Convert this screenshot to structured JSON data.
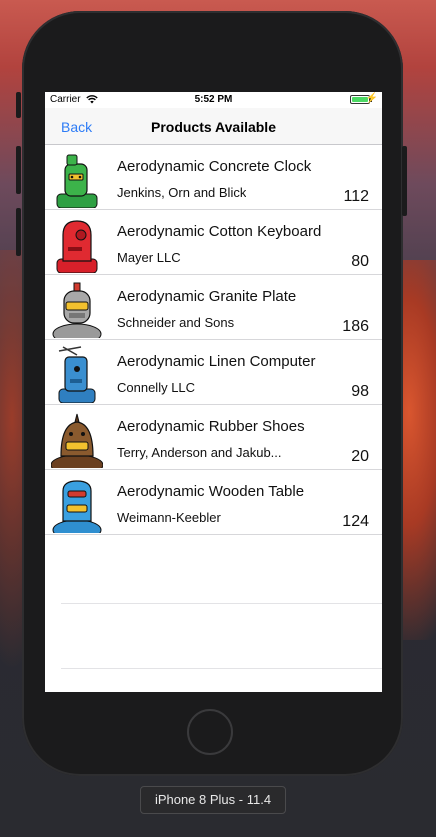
{
  "status_bar": {
    "carrier": "Carrier",
    "time": "5:52 PM",
    "battery_level": 1.0
  },
  "nav": {
    "back_label": "Back",
    "title": "Products Available"
  },
  "products": [
    {
      "name": "Aerodynamic Concrete Clock",
      "maker": "Jenkins, Orn and Blick",
      "quantity": "112",
      "avatar_color": "#2ea043"
    },
    {
      "name": "Aerodynamic Cotton Keyboard",
      "maker": "Mayer LLC",
      "quantity": "80",
      "avatar_color": "#d8202a"
    },
    {
      "name": "Aerodynamic Granite Plate",
      "maker": "Schneider and Sons",
      "quantity": "186",
      "avatar_color": "#8f8f8f"
    },
    {
      "name": "Aerodynamic Linen Computer",
      "maker": "Connelly LLC",
      "quantity": "98",
      "avatar_color": "#2f7fc0"
    },
    {
      "name": "Aerodynamic Rubber Shoes",
      "maker": "Terry, Anderson and Jakub...",
      "quantity": "20",
      "avatar_color": "#7a4a26"
    },
    {
      "name": "Aerodynamic Wooden Table",
      "maker": "Weimann-Keebler",
      "quantity": "124",
      "avatar_color": "#2f8fd0"
    }
  ],
  "simulator": {
    "device_label": "iPhone 8 Plus - 11.4"
  },
  "colors": {
    "accent": "#2e7cf6",
    "battery": "#4cd964"
  }
}
